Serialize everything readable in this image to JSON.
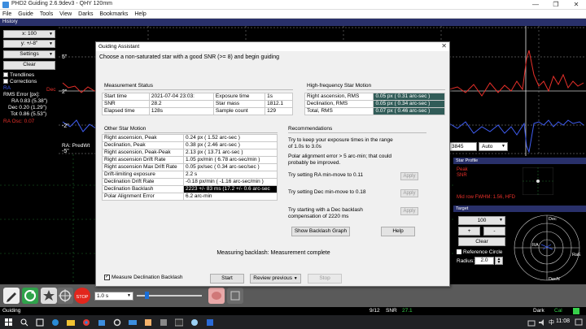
{
  "window": {
    "title": "PHD2 Guiding 2.6.9dev3 - QHY 120mm",
    "controls": [
      "—",
      "❐",
      "✕"
    ]
  },
  "menu": [
    "File",
    "Guide",
    "Tools",
    "View",
    "Darks",
    "Bookmarks",
    "Help"
  ],
  "history": {
    "panel_title": "History",
    "scale_x": "x: 100",
    "scale_y": "y: +/-8\"",
    "settings": "Settings",
    "clear": "Clear",
    "trendlines": "Trendlines",
    "corrections": "Corrections",
    "ra_label": "RA",
    "dec_label": "Dec",
    "rms_title": "RMS Error [px]:",
    "rms_ra": "RA 0.83 (5.38\")",
    "rms_dec": "Dec 0.20 (1.29\")",
    "rms_tot": "Tot 0.86 (5.53\")",
    "ra_osc": "RA Osc: 0.07",
    "y_ticks": [
      "5\"",
      "2\"",
      "-2\"",
      "-5\""
    ],
    "footer_label": "RA: PredWt",
    "colors": {
      "ra": "#e8302a",
      "dec": "#3f5df2",
      "grid": "#9a9a9a"
    }
  },
  "camera_controls": {
    "exposure_value": "3845",
    "gamma": "Auto"
  },
  "star_profile": {
    "title": "Star Profile",
    "peak": "Peak",
    "snr": "SNR",
    "hfd_line": "Mid row FWHM: 1.56, HFD"
  },
  "target": {
    "title": "Target",
    "zoom": "100",
    "plus": "+",
    "minus": "-",
    "clear": "Clear",
    "reference_circle": "Reference Circle",
    "radius_label": "Radius:",
    "radius_value": "2.0",
    "dec_axis": "Dec",
    "ra_axis": "RA",
    "dec_dir": "DecN",
    "ra_dir": "RaE"
  },
  "assistant": {
    "title": "Guiding Assistant",
    "instruction": "Choose a non-saturated star with a good SNR (>= 8) and begin guiding",
    "measurement_status": {
      "title": "Measurement Status",
      "rows": [
        [
          "Start time",
          "2021-07-04 23:03:",
          "Exposure time",
          "1s"
        ],
        [
          "SNR",
          "28.2",
          "Star mass",
          "1812.1"
        ],
        [
          "Elapsed time",
          "128s",
          "Sample count",
          "129"
        ]
      ]
    },
    "hf_motion": {
      "title": "High-frequency Star Motion",
      "rows": [
        [
          "Right ascension, RMS",
          "0.05 px ( 0.31 arc-sec )"
        ],
        [
          "Declination, RMS",
          "0.05 px ( 0.34 arc-sec )"
        ],
        [
          "Total, RMS",
          "0.07 px ( 0.46 arc-sec )"
        ]
      ]
    },
    "other_motion": {
      "title": "Other Star Motion",
      "rows": [
        [
          "Right ascension, Peak",
          "0.24 px ( 1.52 arc-sec )"
        ],
        [
          "Declination, Peak",
          "0.38 px ( 2.46 arc-sec )"
        ],
        [
          "Right ascension, Peak-Peak",
          "2.13 px ( 13.71 arc-sec )"
        ],
        [
          "Right ascension Drift Rate",
          "1.05 px/min ( 6.78 arc-sec/min )"
        ],
        [
          "Right ascension Max Drift Rate",
          "0.05 px/sec ( 0.34 arc-sec/sec )"
        ],
        [
          "Drift-limiting exposure",
          "2.2 s"
        ],
        [
          "Declination Drift Rate",
          "-0.18 px/min ( -1.16 arc-sec/min )"
        ],
        [
          "Declination Backlash",
          "2223  +/-  83 ms (17.2  +/-  0.6 arc-sec"
        ],
        [
          "Polar Alignment Error",
          "6.2 arc-min"
        ]
      ]
    },
    "recommendations": {
      "title": "Recommendations",
      "items": [
        "Try to keep your exposure times in the range\nof 1.0s to 3.0s",
        "Polar alignment error > 5 arc-min; that could\nprobably be improved.",
        "Try setting RA min-move to 0.11",
        "Try setting Dec min-move to 0.18",
        "Try starting with a Dec backlash\ncompensation of 2220 ms"
      ],
      "apply": "Apply",
      "backlash_graph": "Show Backlash Graph",
      "help": "Help"
    },
    "status": "Measuring backlash: Measurement complete",
    "measure_dec_backlash": "Measure Declination Backlash",
    "start": "Start",
    "review_previous": "Review previous",
    "stop": "Stop"
  },
  "toolbar": {
    "exposure": "1.0 s"
  },
  "status_bar": {
    "mode": "Guiding",
    "frame": "9/12",
    "snr_label": "SNR",
    "snr_value": "27.1",
    "dark": "Dark",
    "cal": "Cal"
  },
  "taskbar": {
    "time": "11:08",
    "tray_lang": "中"
  }
}
